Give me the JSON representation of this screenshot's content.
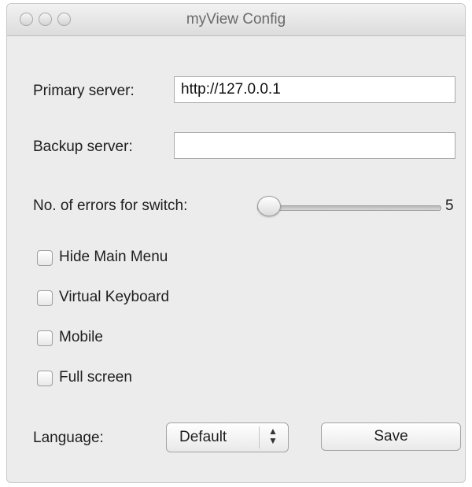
{
  "window": {
    "title": "myView Config"
  },
  "form": {
    "primary_server": {
      "label": "Primary server:",
      "value": "http://127.0.0.1"
    },
    "backup_server": {
      "label": "Backup server:",
      "value": ""
    },
    "errors_slider": {
      "label": "No. of errors for switch:",
      "value": "5"
    },
    "checkboxes": [
      {
        "label": "Hide Main Menu",
        "checked": false
      },
      {
        "label": "Virtual Keyboard",
        "checked": false
      },
      {
        "label": "Mobile",
        "checked": false
      },
      {
        "label": "Full screen",
        "checked": false
      }
    ],
    "language": {
      "label": "Language:",
      "selected": "Default"
    },
    "save_label": "Save"
  }
}
